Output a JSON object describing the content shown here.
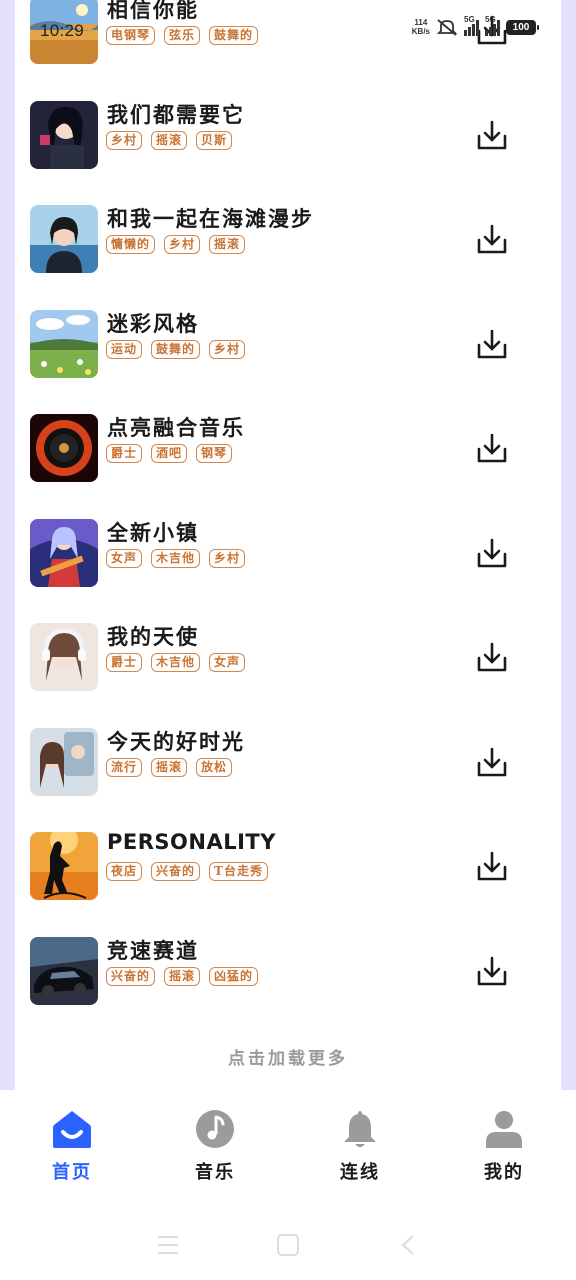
{
  "status_bar": {
    "time": "10:29",
    "speed_value": "114",
    "speed_unit": "KB/s",
    "network1": "5G",
    "network2": "5G",
    "battery": "100"
  },
  "songs": [
    {
      "title": "相信你能",
      "tags": [
        "电钢琴",
        "弦乐",
        "鼓舞的"
      ],
      "thumb_icon": "landscape-cover-icon"
    },
    {
      "title": "我们都需要它",
      "tags": [
        "乡村",
        "摇滚",
        "贝斯"
      ],
      "thumb_icon": "anime-girl-cover-icon"
    },
    {
      "title": "和我一起在海滩漫步",
      "tags": [
        "慵懒的",
        "乡村",
        "摇滚"
      ],
      "thumb_icon": "beach-girl-cover-icon"
    },
    {
      "title": "迷彩风格",
      "tags": [
        "运动",
        "鼓舞的",
        "乡村"
      ],
      "thumb_icon": "meadow-cover-icon"
    },
    {
      "title": "点亮融合音乐",
      "tags": [
        "爵士",
        "酒吧",
        "钢琴"
      ],
      "thumb_icon": "vinyl-fire-cover-icon"
    },
    {
      "title": "全新小镇",
      "tags": [
        "女声",
        "木吉他",
        "乡村"
      ],
      "thumb_icon": "guitar-girl-cover-icon"
    },
    {
      "title": "我的天使",
      "tags": [
        "爵士",
        "木吉他",
        "女声"
      ],
      "thumb_icon": "headphone-girl-cover-icon"
    },
    {
      "title": "今天的好时光",
      "tags": [
        "流行",
        "摇滚",
        "放松"
      ],
      "thumb_icon": "mirror-girl-cover-icon"
    },
    {
      "title": "PERSONALITY",
      "tags": [
        "夜店",
        "兴奋的",
        "T台走秀"
      ],
      "thumb_icon": "singer-silhouette-cover-icon"
    },
    {
      "title": "竞速赛道",
      "tags": [
        "兴奋的",
        "摇滚",
        "凶猛的"
      ],
      "thumb_icon": "race-car-cover-icon"
    }
  ],
  "load_more": "点击加载更多",
  "tabs": [
    {
      "label": "首页",
      "icon": "home-icon",
      "active": true
    },
    {
      "label": "音乐",
      "icon": "music-note-icon",
      "active": false
    },
    {
      "label": "连线",
      "icon": "bell-icon",
      "active": false
    },
    {
      "label": "我的",
      "icon": "user-icon",
      "active": false
    }
  ],
  "colors": {
    "accent": "#2962ff",
    "tag_border": "#d4874d",
    "tag_text": "#c97433",
    "inactive_icon": "#9b9b9b",
    "background": "#e2e0fb"
  }
}
